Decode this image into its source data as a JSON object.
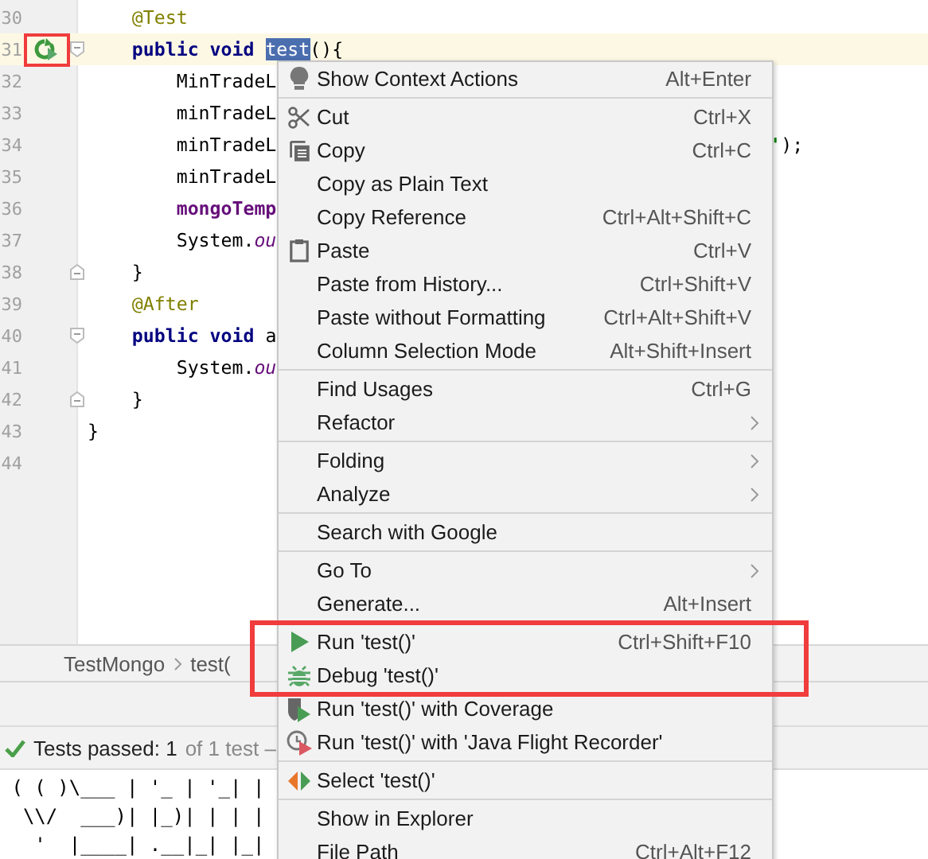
{
  "editor": {
    "lines": [
      {
        "number": "30",
        "current": false,
        "tokens": [
          {
            "kind": "annotation",
            "text": "    @Test"
          }
        ]
      },
      {
        "number": "31",
        "current": true,
        "gutter": {
          "kind": "run",
          "highlighted": true
        },
        "fold_start": true,
        "tokens": [
          {
            "kind": "keyword",
            "text": "    public void "
          },
          {
            "kind": "selected",
            "text": "test"
          },
          {
            "kind": "plain",
            "text": "(){"
          }
        ]
      },
      {
        "number": "32",
        "current": false,
        "tokens": [
          {
            "kind": "plain",
            "text": "        MinTradeL"
          }
        ]
      },
      {
        "number": "33",
        "current": false,
        "tokens": [
          {
            "kind": "plain",
            "text": "        minTradeL"
          }
        ]
      },
      {
        "number": "34",
        "current": false,
        "tokens": [
          {
            "kind": "plain",
            "text": "        minTradeL"
          }
        ],
        "tail": [
          {
            "kind": "string",
            "text": "'"
          },
          {
            "kind": "plain",
            "text": ");"
          }
        ]
      },
      {
        "number": "35",
        "current": false,
        "tokens": [
          {
            "kind": "plain",
            "text": "        minTradeL"
          }
        ]
      },
      {
        "number": "36",
        "current": false,
        "tokens": [
          {
            "kind": "field",
            "text": "        mongoTemp"
          }
        ]
      },
      {
        "number": "37",
        "current": false,
        "tokens": [
          {
            "kind": "plain",
            "text": "        System."
          },
          {
            "kind": "static",
            "text": "ou"
          }
        ]
      },
      {
        "number": "38",
        "current": false,
        "fold_end": true,
        "tokens": [
          {
            "kind": "plain",
            "text": "    }"
          }
        ]
      },
      {
        "number": "39",
        "current": false,
        "tokens": [
          {
            "kind": "annotation",
            "text": "    @After"
          }
        ]
      },
      {
        "number": "40",
        "current": false,
        "fold_start": true,
        "tokens": [
          {
            "kind": "keyword",
            "text": "    public void "
          },
          {
            "kind": "plain",
            "text": "a"
          }
        ]
      },
      {
        "number": "41",
        "current": false,
        "tokens": [
          {
            "kind": "plain",
            "text": "        System."
          },
          {
            "kind": "static",
            "text": "ou"
          }
        ]
      },
      {
        "number": "42",
        "current": false,
        "fold_end": true,
        "tokens": [
          {
            "kind": "plain",
            "text": "    }"
          }
        ]
      },
      {
        "number": "43",
        "current": false,
        "tokens": [
          {
            "kind": "plain",
            "text": "}"
          }
        ]
      },
      {
        "number": "44",
        "current": false
      }
    ]
  },
  "breadcrumb": [
    "TestMongo",
    "test("
  ],
  "test_status": {
    "label": "Tests passed: 1",
    "detail": "of 1 test –"
  },
  "console": {
    "lines": [
      " ( ( )\\___ | '_ | '_| |",
      "  \\\\/  ___)| |_)| | | |",
      "   '  |____| .__|_| |_|"
    ]
  },
  "context_menu": {
    "groups": [
      {
        "divider": false,
        "highlighted": false,
        "items": [
          {
            "label": "Show Context Actions",
            "shortcut": "Alt+Enter",
            "kind": "bulb"
          }
        ]
      },
      {
        "divider": true,
        "highlighted": false,
        "items": [
          {
            "label": "Cut",
            "shortcut": "Ctrl+X",
            "kind": "scissors"
          },
          {
            "label": "Copy",
            "shortcut": "Ctrl+C",
            "kind": "copy"
          },
          {
            "label": "Copy as Plain Text"
          },
          {
            "label": "Copy Reference",
            "shortcut": "Ctrl+Alt+Shift+C"
          },
          {
            "label": "Paste",
            "shortcut": "Ctrl+V",
            "kind": "clipboard"
          },
          {
            "label": "Paste from History...",
            "shortcut": "Ctrl+Shift+V"
          },
          {
            "label": "Paste without Formatting",
            "shortcut": "Ctrl+Alt+Shift+V"
          },
          {
            "label": "Column Selection Mode",
            "shortcut": "Alt+Shift+Insert"
          }
        ]
      },
      {
        "divider": true,
        "highlighted": false,
        "items": [
          {
            "label": "Find Usages",
            "shortcut": "Ctrl+G"
          },
          {
            "label": "Refactor",
            "submenu": true
          }
        ]
      },
      {
        "divider": true,
        "highlighted": false,
        "items": [
          {
            "label": "Folding",
            "submenu": true
          },
          {
            "label": "Analyze",
            "submenu": true
          }
        ]
      },
      {
        "divider": true,
        "highlighted": false,
        "items": [
          {
            "label": "Search with Google"
          }
        ]
      },
      {
        "divider": true,
        "highlighted": false,
        "items": [
          {
            "label": "Go To",
            "submenu": true
          },
          {
            "label": "Generate...",
            "shortcut": "Alt+Insert"
          }
        ]
      },
      {
        "divider": true,
        "highlighted": true,
        "items": [
          {
            "label": "Run 'test()'",
            "shortcut": "Ctrl+Shift+F10",
            "kind": "run"
          },
          {
            "label": "Debug 'test()'",
            "kind": "bug"
          }
        ]
      },
      {
        "divider": false,
        "highlighted": false,
        "items": [
          {
            "label": "Run 'test()' with Coverage",
            "kind": "coverage"
          },
          {
            "label": "Run 'test()' with 'Java Flight Recorder'",
            "kind": "recorder"
          }
        ]
      },
      {
        "divider": true,
        "highlighted": false,
        "items": [
          {
            "label": "Select 'test()'",
            "kind": "select"
          }
        ]
      },
      {
        "divider": true,
        "highlighted": false,
        "items": [
          {
            "label": "Show in Explorer"
          },
          {
            "label": "File Path",
            "shortcut": "Ctrl+Alt+F12"
          }
        ]
      }
    ]
  }
}
